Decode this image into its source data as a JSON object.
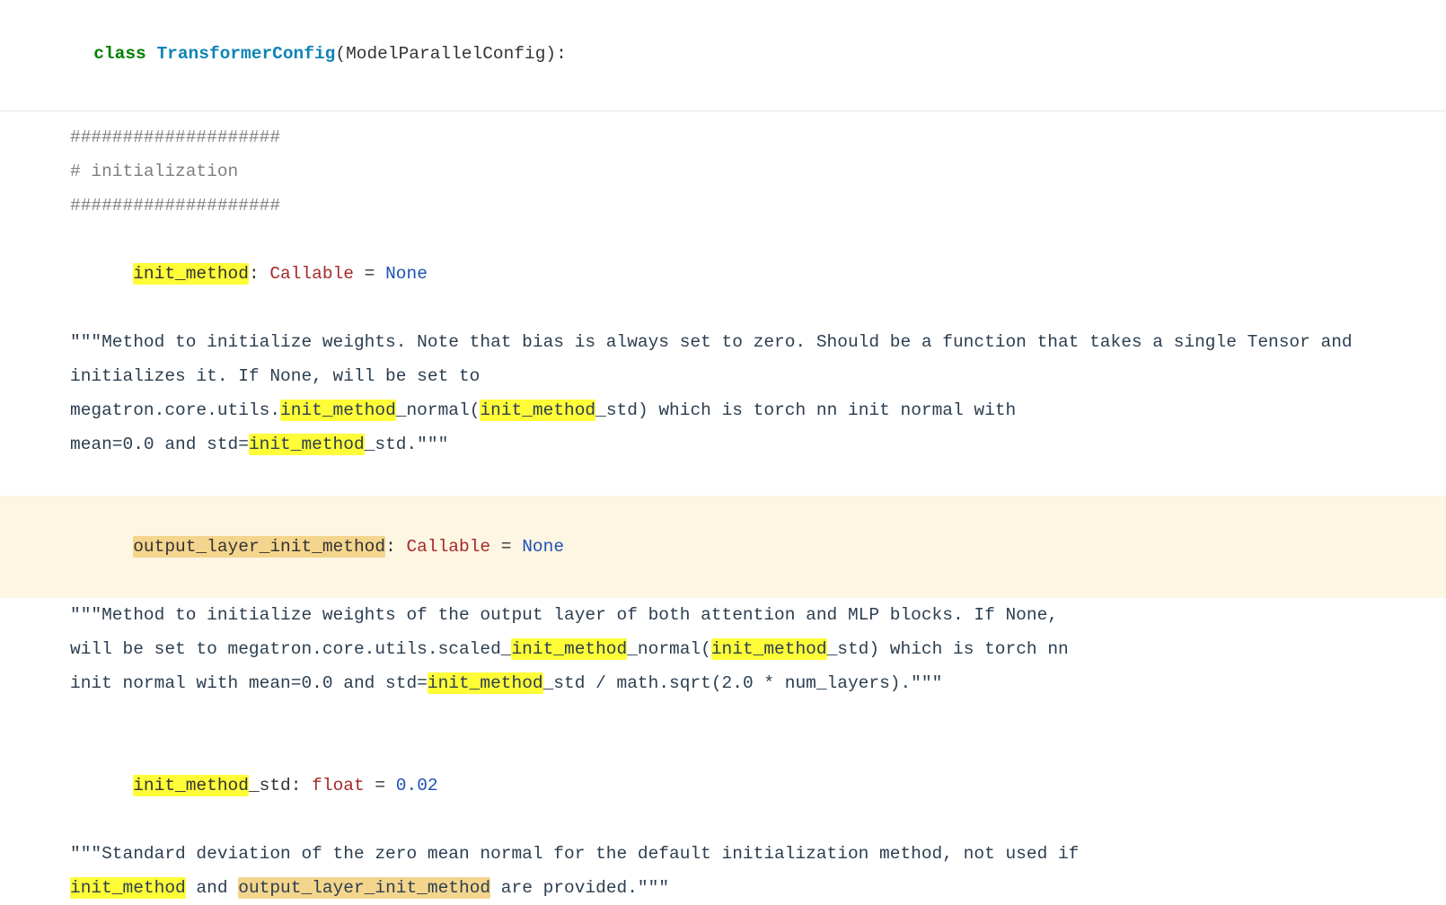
{
  "sig": {
    "kw": "class",
    "name": "TransformerConfig",
    "base": "ModelParallelConfig"
  },
  "comment_bar": "####################",
  "comment_header": "# initialization",
  "init_method": {
    "name": "init_method",
    "type": "Callable",
    "default": "None",
    "doc_open": "\"\"\"Method to initialize weights. Note that bias is always set to zero. Should be a function that takes a single Tensor and initializes it. If None, will be set to",
    "doc_line3_a": "megatron.core.utils.",
    "doc_line3_b": "_normal(",
    "doc_line3_c": "_std) which is torch nn init normal with",
    "doc_line4_a": "mean=0.0 and std=",
    "doc_line4_b": "_std.\"\"\""
  },
  "output_layer": {
    "prefix": "output_layer_",
    "suffix": "init_method",
    "type": "Callable",
    "default": "None",
    "doc1": "\"\"\"Method to initialize weights of the output layer of both attention and MLP blocks. If None,",
    "doc2_a": "will be set to megatron.core.utils.scaled_",
    "doc2_b": "_normal(",
    "doc2_c": "_std) which is torch nn",
    "doc3_a": "init normal with mean=0.0 and std=",
    "doc3_b": "_std / math.sqrt(2.0 * num_layers).\"\"\""
  },
  "init_std": {
    "name_hl": "init_method",
    "name_suffix": "_std",
    "type": "float",
    "default": "0.02",
    "doc1": "\"\"\"Standard deviation of the zero mean normal for the default initialization method, not used if",
    "doc2_mid": " and ",
    "doc2_tan_prefix": "output_layer_",
    "doc2_tan_suffix": "init_method",
    "doc2_tail": " are provided.\"\"\""
  },
  "hl_term": "init_method"
}
